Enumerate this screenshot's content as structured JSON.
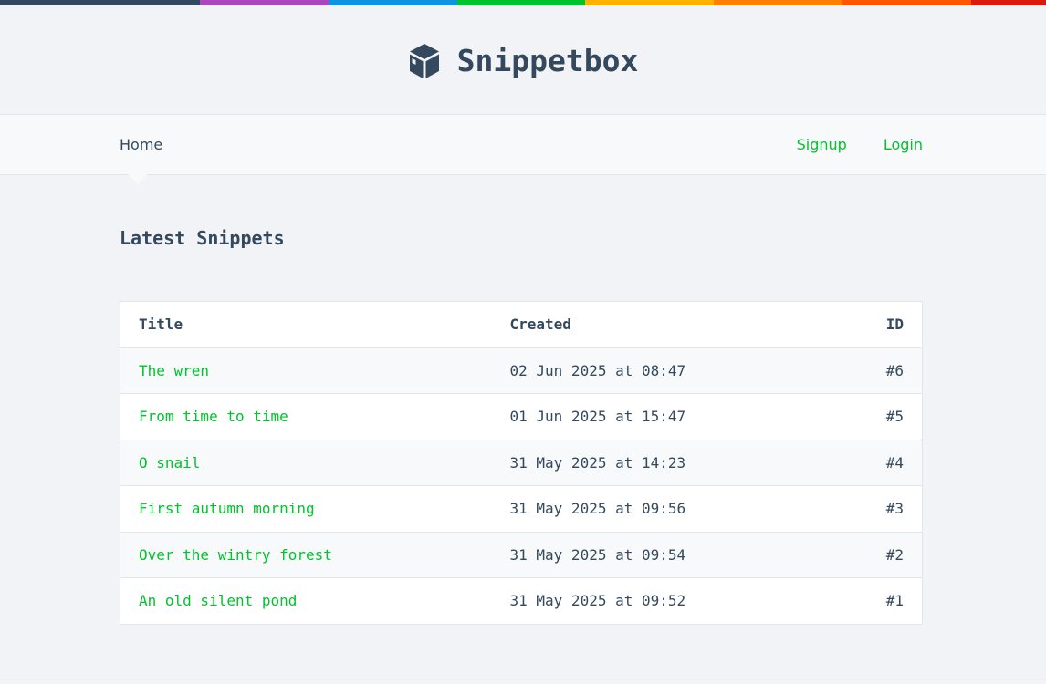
{
  "theme": {
    "rainbow_colors": [
      "#34495E",
      "#AB47BC",
      "#0E93E0",
      "#00C32D",
      "#FFB300",
      "#FF7F00",
      "#FF5500",
      "#DB1A0E"
    ],
    "link_color": "#00C32D",
    "text_color": "#34495E",
    "background": "#F1F3F6"
  },
  "header": {
    "logo_icon": "cube-icon",
    "site_name": "Snippetbox"
  },
  "nav": {
    "home_label": "Home",
    "signup_label": "Signup",
    "login_label": "Login"
  },
  "main": {
    "page_title": "Latest Snippets",
    "table": {
      "columns": [
        "Title",
        "Created",
        "ID"
      ],
      "rows": [
        {
          "title": "The wren",
          "created": "02 Jun 2025 at 08:47",
          "id": "#6"
        },
        {
          "title": "From time to time",
          "created": "01 Jun 2025 at 15:47",
          "id": "#5"
        },
        {
          "title": "O snail",
          "created": "31 May 2025 at 14:23",
          "id": "#4"
        },
        {
          "title": "First autumn morning",
          "created": "31 May 2025 at 09:56",
          "id": "#3"
        },
        {
          "title": "Over the wintry forest",
          "created": "31 May 2025 at 09:54",
          "id": "#2"
        },
        {
          "title": "An old silent pond",
          "created": "31 May 2025 at 09:52",
          "id": "#1"
        }
      ]
    }
  }
}
